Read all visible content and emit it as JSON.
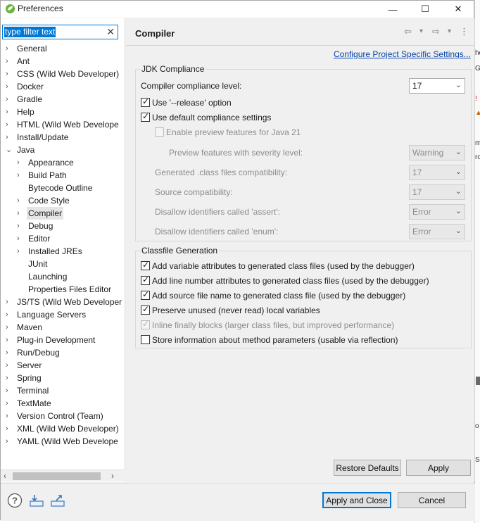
{
  "window": {
    "title": "Preferences",
    "controls": {
      "minimize": "—",
      "maximize": "☐",
      "close": "✕"
    }
  },
  "filter": {
    "placeholder": "type filter text",
    "value": "type filter text",
    "clear_icon": "✕"
  },
  "tree": [
    {
      "label": "General",
      "twisty": "›",
      "level": 0
    },
    {
      "label": "Ant",
      "twisty": "›",
      "level": 0
    },
    {
      "label": "CSS (Wild Web Developer)",
      "twisty": "›",
      "level": 0
    },
    {
      "label": "Docker",
      "twisty": "›",
      "level": 0
    },
    {
      "label": "Gradle",
      "twisty": "›",
      "level": 0
    },
    {
      "label": "Help",
      "twisty": "›",
      "level": 0
    },
    {
      "label": "HTML (Wild Web Develope",
      "twisty": "›",
      "level": 0
    },
    {
      "label": "Install/Update",
      "twisty": "›",
      "level": 0
    },
    {
      "label": "Java",
      "twisty": "⌄",
      "level": 0
    },
    {
      "label": "Appearance",
      "twisty": "›",
      "level": 1
    },
    {
      "label": "Build Path",
      "twisty": "›",
      "level": 1
    },
    {
      "label": "Bytecode Outline",
      "twisty": "",
      "level": 1
    },
    {
      "label": "Code Style",
      "twisty": "›",
      "level": 1
    },
    {
      "label": "Compiler",
      "twisty": "›",
      "level": 1,
      "selected": true
    },
    {
      "label": "Debug",
      "twisty": "›",
      "level": 1
    },
    {
      "label": "Editor",
      "twisty": "›",
      "level": 1
    },
    {
      "label": "Installed JREs",
      "twisty": "›",
      "level": 1
    },
    {
      "label": "JUnit",
      "twisty": "",
      "level": 1
    },
    {
      "label": "Launching",
      "twisty": "",
      "level": 1
    },
    {
      "label": "Properties Files Editor",
      "twisty": "",
      "level": 1
    },
    {
      "label": "JS/TS (Wild Web Developer",
      "twisty": "›",
      "level": 0
    },
    {
      "label": "Language Servers",
      "twisty": "›",
      "level": 0
    },
    {
      "label": "Maven",
      "twisty": "›",
      "level": 0
    },
    {
      "label": "Plug-in Development",
      "twisty": "›",
      "level": 0
    },
    {
      "label": "Run/Debug",
      "twisty": "›",
      "level": 0
    },
    {
      "label": "Server",
      "twisty": "›",
      "level": 0
    },
    {
      "label": "Spring",
      "twisty": "›",
      "level": 0
    },
    {
      "label": "Terminal",
      "twisty": "›",
      "level": 0
    },
    {
      "label": "TextMate",
      "twisty": "›",
      "level": 0
    },
    {
      "label": "Version Control (Team)",
      "twisty": "›",
      "level": 0
    },
    {
      "label": "XML (Wild Web Developer)",
      "twisty": "›",
      "level": 0
    },
    {
      "label": "YAML (Wild Web Develope",
      "twisty": "›",
      "level": 0
    }
  ],
  "hscroll": {
    "left_arrow": "‹",
    "right_arrow": "›"
  },
  "page": {
    "title": "Compiler",
    "nav": {
      "back": "⇦",
      "back_menu": "▾",
      "forward": "⇨",
      "forward_menu": "▾",
      "more": "⋮"
    },
    "configure_link": "Configure Project Specific Settings..."
  },
  "jdk": {
    "group_title": "JDK Compliance",
    "compliance_label": "Compiler compliance level:",
    "compliance_value": "17",
    "use_release": {
      "label": "Use '--release' option",
      "checked": true,
      "enabled": true
    },
    "use_default": {
      "label": "Use default compliance settings",
      "checked": true,
      "enabled": true
    },
    "preview": {
      "label": "Enable preview features for Java 21",
      "checked": false,
      "enabled": false
    },
    "rows": [
      {
        "label": "Preview features with severity level:",
        "value": "Warning",
        "indent": true
      },
      {
        "label": "Generated .class files compatibility:",
        "value": "17",
        "indent": false
      },
      {
        "label": "Source compatibility:",
        "value": "17",
        "indent": false
      },
      {
        "label": "Disallow identifiers called 'assert':",
        "value": "Error",
        "indent": false
      },
      {
        "label": "Disallow identifiers called 'enum':",
        "value": "Error",
        "indent": false
      }
    ]
  },
  "classfile": {
    "group_title": "Classfile Generation",
    "options": [
      {
        "label": "Add variable attributes to generated class files (used by the debugger)",
        "checked": true,
        "enabled": true
      },
      {
        "label": "Add line number attributes to generated class files (used by the debugger)",
        "checked": true,
        "enabled": true
      },
      {
        "label": "Add source file name to generated class file (used by the debugger)",
        "checked": true,
        "enabled": true
      },
      {
        "label": "Preserve unused (never read) local variables",
        "checked": true,
        "enabled": true
      },
      {
        "label": "Inline finally blocks (larger class files, but improved performance)",
        "checked": true,
        "enabled": false
      },
      {
        "label": "Store information about method parameters (usable via reflection)",
        "checked": false,
        "enabled": true
      }
    ]
  },
  "buttons": {
    "restore_defaults": "Restore Defaults",
    "apply": "Apply",
    "apply_and_close": "Apply and Close",
    "cancel": "Cancel"
  },
  "bottom_icons": {
    "help": "help-icon",
    "import": "import-icon",
    "export": "export-icon"
  },
  "check_glyph": "✓",
  "colors": {
    "accent": "#0078d7",
    "link": "#0645ad",
    "disabled_text": "#8c8c8c"
  }
}
